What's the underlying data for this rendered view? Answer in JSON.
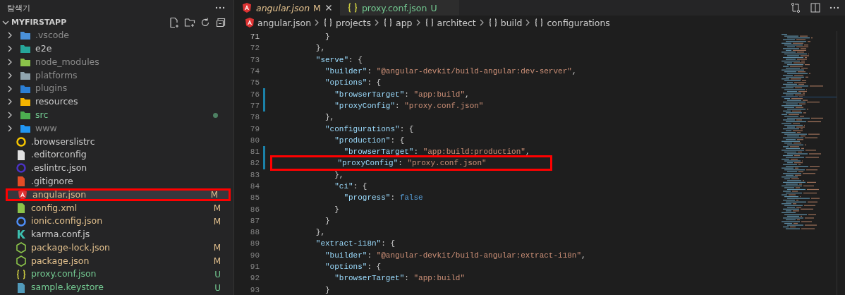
{
  "explorer": {
    "title": "탐색기",
    "section": {
      "label": "MYFIRSTAPP",
      "expanded": true
    },
    "items": [
      {
        "name": ".vscode",
        "kind": "folder",
        "color": "#4a90d9",
        "modified": false,
        "untracked": false,
        "ignored": true,
        "dot": false,
        "selected": false
      },
      {
        "name": "e2e",
        "kind": "folder",
        "color": "#26a69a",
        "modified": false,
        "untracked": false,
        "ignored": false,
        "dot": false,
        "selected": false
      },
      {
        "name": "node_modules",
        "kind": "folder",
        "color": "#8bc34a",
        "modified": false,
        "untracked": false,
        "ignored": true,
        "dot": false,
        "selected": false
      },
      {
        "name": "platforms",
        "kind": "folder",
        "color": "#90a4ae",
        "modified": false,
        "untracked": false,
        "ignored": true,
        "dot": false,
        "selected": false
      },
      {
        "name": "plugins",
        "kind": "folder",
        "color": "#2b7fd6",
        "modified": false,
        "untracked": false,
        "ignored": true,
        "dot": false,
        "selected": false
      },
      {
        "name": "resources",
        "kind": "folder",
        "color": "#f4b400",
        "modified": false,
        "untracked": false,
        "ignored": false,
        "dot": false,
        "selected": false
      },
      {
        "name": "src",
        "kind": "folder",
        "color": "#4caf50",
        "modified": false,
        "untracked": true,
        "ignored": false,
        "dot": true,
        "selected": false
      },
      {
        "name": "www",
        "kind": "folder",
        "color": "#2196f3",
        "modified": false,
        "untracked": false,
        "ignored": true,
        "dot": false,
        "selected": false
      },
      {
        "name": ".browserslistrc",
        "kind": "ring",
        "color": "#f7c600",
        "modified": false,
        "untracked": false,
        "ignored": false,
        "dot": false,
        "selected": false
      },
      {
        "name": ".editorconfig",
        "kind": "file",
        "color": "#e0e0e0",
        "modified": false,
        "untracked": false,
        "ignored": false,
        "dot": false,
        "selected": false
      },
      {
        "name": ".eslintrc.json",
        "kind": "ring",
        "color": "#4b32c3",
        "modified": false,
        "untracked": false,
        "ignored": false,
        "dot": false,
        "selected": false
      },
      {
        "name": ".gitignore",
        "kind": "file",
        "color": "#e44d26",
        "modified": false,
        "untracked": false,
        "ignored": false,
        "dot": false,
        "selected": false
      },
      {
        "name": "angular.json",
        "kind": "angular",
        "color": "#dd3333",
        "modified": true,
        "untracked": false,
        "ignored": false,
        "badge": "M",
        "dot": false,
        "selected": true
      },
      {
        "name": "config.xml",
        "kind": "file",
        "color": "#8bc34a",
        "modified": true,
        "untracked": false,
        "ignored": false,
        "badge": "M",
        "dot": false,
        "selected": false
      },
      {
        "name": "ionic.config.json",
        "kind": "ring",
        "color": "#4e8ef7",
        "modified": true,
        "untracked": false,
        "ignored": false,
        "badge": "M",
        "dot": false,
        "selected": false
      },
      {
        "name": "karma.conf.js",
        "kind": "letter",
        "color": "#3cbeae",
        "modified": false,
        "untracked": false,
        "ignored": false,
        "dot": false,
        "selected": false
      },
      {
        "name": "package-lock.json",
        "kind": "hexagon",
        "color": "#8bc34a",
        "modified": true,
        "untracked": false,
        "ignored": false,
        "badge": "M",
        "dot": false,
        "selected": false
      },
      {
        "name": "package.json",
        "kind": "hexagon",
        "color": "#8bc34a",
        "modified": true,
        "untracked": false,
        "ignored": false,
        "badge": "M",
        "dot": false,
        "selected": false
      },
      {
        "name": "proxy.conf.json",
        "kind": "braces",
        "color": "#cbcb41",
        "modified": false,
        "untracked": true,
        "ignored": false,
        "badge": "U",
        "dot": false,
        "selected": false
      },
      {
        "name": "sample.keystore",
        "kind": "file",
        "color": "#519aba",
        "modified": false,
        "untracked": true,
        "ignored": false,
        "badge": "U",
        "dot": false,
        "selected": false
      }
    ]
  },
  "editor": {
    "tabs": [
      {
        "label": "angular.json",
        "badge": "M",
        "modified": true,
        "untracked": false,
        "kind": "angular",
        "selected": true
      },
      {
        "label": "proxy.conf.json",
        "badge": "U",
        "modified": false,
        "untracked": true,
        "kind": "braces",
        "selected": false
      }
    ],
    "breadcrumbs": [
      {
        "label": "angular.json",
        "kind": "angular"
      },
      {
        "label": "projects",
        "kind": "object"
      },
      {
        "label": "app",
        "kind": "object"
      },
      {
        "label": "architect",
        "kind": "object"
      },
      {
        "label": "build",
        "kind": "object"
      },
      {
        "label": "configurations",
        "kind": "object"
      }
    ],
    "lines": [
      {
        "number": "71",
        "modified": false,
        "highlighted": false,
        "tokens": [
          {
            "kind": "punct",
            "text": "          }"
          }
        ]
      },
      {
        "number": "72",
        "modified": false,
        "highlighted": false,
        "tokens": [
          {
            "kind": "punct",
            "text": "        },"
          }
        ]
      },
      {
        "number": "73",
        "modified": false,
        "highlighted": false,
        "tokens": [
          {
            "kind": "key",
            "text": "        \"serve\""
          },
          {
            "kind": "punct",
            "text": ": {"
          }
        ]
      },
      {
        "number": "74",
        "modified": false,
        "highlighted": false,
        "tokens": [
          {
            "kind": "key",
            "text": "          \"builder\""
          },
          {
            "kind": "punct",
            "text": ": "
          },
          {
            "kind": "string",
            "text": "\"@angular-devkit/build-angular:dev-server\""
          },
          {
            "kind": "punct",
            "text": ","
          }
        ]
      },
      {
        "number": "75",
        "modified": false,
        "highlighted": false,
        "tokens": [
          {
            "kind": "key",
            "text": "          \"options\""
          },
          {
            "kind": "punct",
            "text": ": {"
          }
        ]
      },
      {
        "number": "76",
        "modified": true,
        "highlighted": false,
        "tokens": [
          {
            "kind": "key",
            "text": "            \"browserTarget\""
          },
          {
            "kind": "punct",
            "text": ": "
          },
          {
            "kind": "string",
            "text": "\"app:build\""
          },
          {
            "kind": "punct",
            "text": ","
          }
        ]
      },
      {
        "number": "77",
        "modified": true,
        "highlighted": false,
        "tokens": [
          {
            "kind": "key",
            "text": "            \"proxyConfig\""
          },
          {
            "kind": "punct",
            "text": ": "
          },
          {
            "kind": "string",
            "text": "\"proxy.conf.json\""
          }
        ]
      },
      {
        "number": "78",
        "modified": false,
        "highlighted": false,
        "tokens": [
          {
            "kind": "punct",
            "text": "          },"
          }
        ]
      },
      {
        "number": "79",
        "modified": false,
        "highlighted": false,
        "tokens": [
          {
            "kind": "key",
            "text": "          \"configurations\""
          },
          {
            "kind": "punct",
            "text": ": {"
          }
        ]
      },
      {
        "number": "80",
        "modified": false,
        "highlighted": false,
        "tokens": [
          {
            "kind": "key",
            "text": "            \"production\""
          },
          {
            "kind": "punct",
            "text": ": {"
          }
        ]
      },
      {
        "number": "81",
        "modified": true,
        "highlighted": false,
        "tokens": [
          {
            "kind": "key",
            "text": "              \"browserTarget\""
          },
          {
            "kind": "punct",
            "text": ": "
          },
          {
            "kind": "string",
            "text": "\"app:build:production\""
          },
          {
            "kind": "punct",
            "text": ","
          }
        ]
      },
      {
        "number": "82",
        "modified": true,
        "highlighted": true,
        "tokens": [
          {
            "kind": "key",
            "text": "              \"proxyConfig\""
          },
          {
            "kind": "punct",
            "text": ": "
          },
          {
            "kind": "string",
            "text": "\"proxy.conf.json\""
          }
        ]
      },
      {
        "number": "83",
        "modified": false,
        "highlighted": false,
        "tokens": [
          {
            "kind": "punct",
            "text": "            },"
          }
        ]
      },
      {
        "number": "84",
        "modified": false,
        "highlighted": false,
        "tokens": [
          {
            "kind": "key",
            "text": "            \"ci\""
          },
          {
            "kind": "punct",
            "text": ": {"
          }
        ]
      },
      {
        "number": "85",
        "modified": false,
        "highlighted": false,
        "tokens": [
          {
            "kind": "key",
            "text": "              \"progress\""
          },
          {
            "kind": "punct",
            "text": ": "
          },
          {
            "kind": "bool",
            "text": "false"
          }
        ]
      },
      {
        "number": "86",
        "modified": false,
        "highlighted": false,
        "tokens": [
          {
            "kind": "punct",
            "text": "            }"
          }
        ]
      },
      {
        "number": "87",
        "modified": false,
        "highlighted": false,
        "tokens": [
          {
            "kind": "punct",
            "text": "          }"
          }
        ]
      },
      {
        "number": "88",
        "modified": false,
        "highlighted": false,
        "tokens": [
          {
            "kind": "punct",
            "text": "        },"
          }
        ]
      },
      {
        "number": "89",
        "modified": false,
        "highlighted": false,
        "tokens": [
          {
            "kind": "key",
            "text": "        \"extract-i18n\""
          },
          {
            "kind": "punct",
            "text": ": {"
          }
        ]
      },
      {
        "number": "90",
        "modified": false,
        "highlighted": false,
        "tokens": [
          {
            "kind": "key",
            "text": "          \"builder\""
          },
          {
            "kind": "punct",
            "text": ": "
          },
          {
            "kind": "string",
            "text": "\"@angular-devkit/build-angular:extract-i18n\""
          },
          {
            "kind": "punct",
            "text": ","
          }
        ]
      },
      {
        "number": "91",
        "modified": false,
        "highlighted": false,
        "tokens": [
          {
            "kind": "key",
            "text": "          \"options\""
          },
          {
            "kind": "punct",
            "text": ": {"
          }
        ]
      },
      {
        "number": "92",
        "modified": false,
        "highlighted": false,
        "tokens": [
          {
            "kind": "key",
            "text": "            \"browserTarget\""
          },
          {
            "kind": "punct",
            "text": ": "
          },
          {
            "kind": "string",
            "text": "\"app:build\""
          }
        ]
      },
      {
        "number": "93",
        "modified": false,
        "highlighted": false,
        "tokens": [
          {
            "kind": "punct",
            "text": "          }"
          }
        ]
      }
    ]
  }
}
